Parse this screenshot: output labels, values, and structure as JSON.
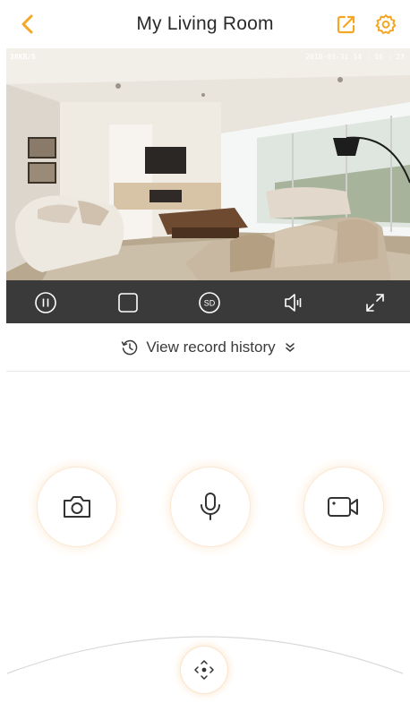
{
  "header": {
    "title": "My Living Room",
    "back_icon": "chevron-left-icon",
    "share_icon": "share-icon",
    "settings_icon": "gear-icon"
  },
  "video": {
    "speed": "38KB/S",
    "timestamp": "2018-03-31 14 : 16 : 23"
  },
  "controls": [
    {
      "icon": "pause-icon"
    },
    {
      "icon": "stop-square-icon"
    },
    {
      "icon": "sd-quality-icon",
      "label": "SD"
    },
    {
      "icon": "speaker-icon"
    },
    {
      "icon": "fullscreen-icon"
    }
  ],
  "history": {
    "label": "View record history",
    "icon": "history-clock-icon",
    "expand_icon": "double-chevron-down-icon"
  },
  "actions": [
    {
      "icon": "camera-icon"
    },
    {
      "icon": "microphone-icon"
    },
    {
      "icon": "video-record-icon"
    }
  ],
  "ptz": {
    "icon": "direction-pad-icon"
  },
  "colors": {
    "accent": "#f5a623",
    "control_bar": "#3a3a3a",
    "icon_stroke": "#333333"
  }
}
